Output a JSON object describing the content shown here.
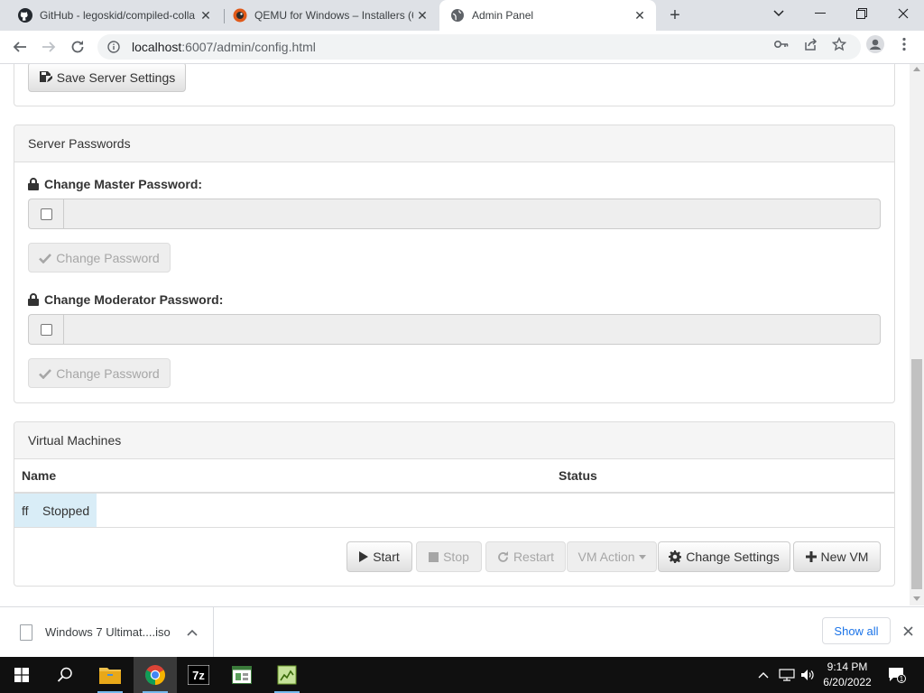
{
  "browser": {
    "tabs": [
      {
        "title": "GitHub - legoskid/compiled-colla",
        "icon": "github-icon",
        "active": false
      },
      {
        "title": "QEMU for Windows – Installers (6",
        "icon": "qemu-icon",
        "active": false
      },
      {
        "title": "Admin Panel",
        "icon": "globe-icon",
        "active": true
      }
    ],
    "url_host": "localhost",
    "url_rest": ":6007/admin/config.html"
  },
  "server_settings": {
    "save_button": "Save Server Settings"
  },
  "passwords": {
    "heading": "Server Passwords",
    "master_label": "Change Master Password:",
    "master_button": "Change Password",
    "moderator_label": "Change Moderator Password:",
    "moderator_button": "Change Password"
  },
  "vms": {
    "heading": "Virtual Machines",
    "columns": [
      "Name",
      "Status"
    ],
    "rows": [
      {
        "name": "ff",
        "status": "Stopped"
      }
    ],
    "actions": {
      "start": "Start",
      "stop": "Stop",
      "restart": "Restart",
      "vm_action": "VM Action",
      "change_settings": "Change Settings",
      "new_vm": "New VM"
    }
  },
  "downloads": {
    "file": "Windows 7 Ultimat....iso",
    "show_all": "Show all"
  },
  "taskbar": {
    "time": "9:14 PM",
    "date": "6/20/2022",
    "notifications": "1"
  }
}
